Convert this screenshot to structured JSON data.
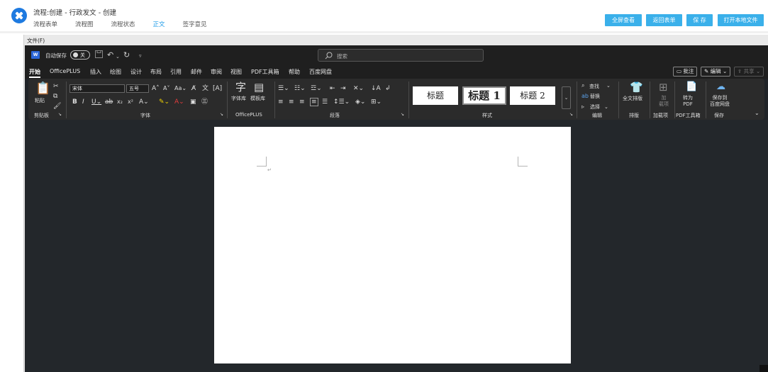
{
  "app": {
    "title": "流程:创建 - 行政发文 - 创建",
    "tabs": [
      "流程表单",
      "流程图",
      "流程状态",
      "正文",
      "签字意见"
    ],
    "active_tab": "正文",
    "buttons": [
      "全屏查看",
      "返回表单",
      "保 存",
      "打开本地文件"
    ],
    "brand_color": "#1e7ae0",
    "button_color": "#3ab0ea"
  },
  "editor": {
    "file_menu": "文件(F)",
    "titlebar": {
      "app_icon": "word-icon",
      "autosave_label": "自动保存",
      "autosave_state": "关",
      "search_placeholder": "搜索"
    },
    "menu_tabs": [
      "开始",
      "OfficePLUS",
      "插入",
      "绘图",
      "设计",
      "布局",
      "引用",
      "邮件",
      "审阅",
      "视图",
      "PDF工具箱",
      "帮助",
      "百度网盘"
    ],
    "active_menu_tab": "开始",
    "right_buttons": {
      "comments": "批注",
      "editing": "编辑",
      "share": "共享"
    },
    "ribbon": {
      "clipboard": {
        "paste": "粘贴",
        "label": "剪贴板"
      },
      "font": {
        "font_name": "宋体",
        "font_size": "五号",
        "label": "字体"
      },
      "officeplus": {
        "font_library": "字体库",
        "template_library": "模板库",
        "label": "OfficePLUS"
      },
      "paragraph": {
        "label": "段落"
      },
      "styles": {
        "items": [
          "标题",
          "标题 1",
          "标题 2"
        ],
        "label": "样式"
      },
      "editing": {
        "find": "查找",
        "replace": "替换",
        "select": "选择",
        "label": "编辑"
      },
      "layout": {
        "full_text": "全文排版",
        "label": "排版"
      },
      "addins": {
        "addin": "加\n载项",
        "label": "加载项"
      },
      "pdf": {
        "convert": "转为\nPDF",
        "label": "PDF工具箱"
      },
      "save": {
        "save_to": "保存到\n百度网盘",
        "label": "保存"
      }
    },
    "dark_background": "#202327",
    "page_color": "#ffffff"
  }
}
